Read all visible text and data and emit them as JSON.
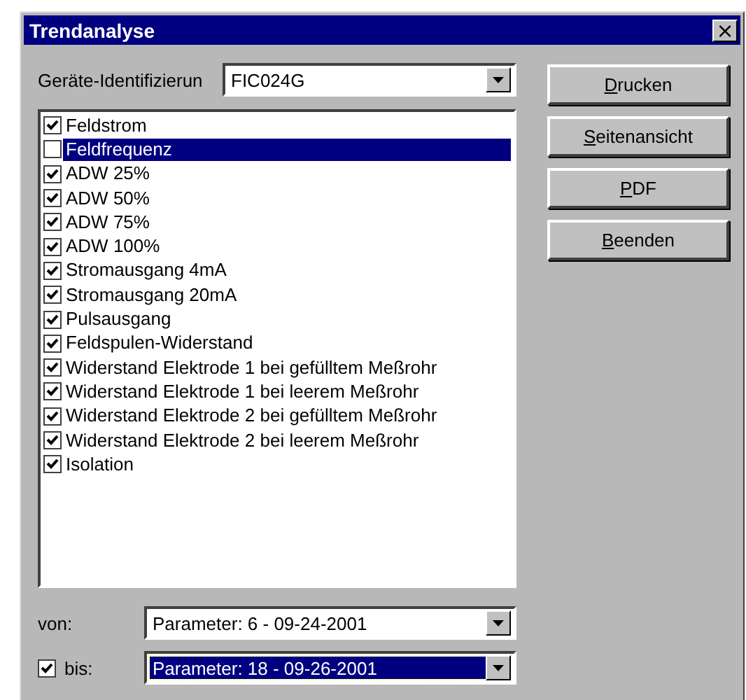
{
  "window": {
    "title": "Trendanalyse",
    "close": "×"
  },
  "device": {
    "label": "Geräte-Identifizierun",
    "value": "FIC024G"
  },
  "parameters": [
    {
      "label": "Feldstrom",
      "checked": true,
      "selected": false
    },
    {
      "label": "Feldfrequenz",
      "checked": false,
      "selected": true
    },
    {
      "label": "ADW 25%",
      "checked": true,
      "selected": false
    },
    {
      "label": "ADW 50%",
      "checked": true,
      "selected": false
    },
    {
      "label": "ADW 75%",
      "checked": true,
      "selected": false
    },
    {
      "label": "ADW 100%",
      "checked": true,
      "selected": false
    },
    {
      "label": "Stromausgang 4mA",
      "checked": true,
      "selected": false
    },
    {
      "label": "Stromausgang 20mA",
      "checked": true,
      "selected": false
    },
    {
      "label": "Pulsausgang",
      "checked": true,
      "selected": false
    },
    {
      "label": "Feldspulen-Widerstand",
      "checked": true,
      "selected": false
    },
    {
      "label": "Widerstand Elektrode 1 bei gefülltem Meßrohr",
      "checked": true,
      "selected": false
    },
    {
      "label": "Widerstand Elektrode 1 bei leerem Meßrohr",
      "checked": true,
      "selected": false
    },
    {
      "label": "Widerstand Elektrode 2 bei gefülltem Meßrohr",
      "checked": true,
      "selected": false
    },
    {
      "label": "Widerstand Elektrode 2 bei leerem Meßrohr",
      "checked": true,
      "selected": false
    },
    {
      "label": "Isolation",
      "checked": true,
      "selected": false
    }
  ],
  "range": {
    "from": {
      "label": "von:",
      "value": "Parameter: 6 - 09-24-2001",
      "focused": false
    },
    "to": {
      "label": "bis:",
      "checked": true,
      "value": "Parameter: 18 - 09-26-2001",
      "focused": true
    }
  },
  "buttons": [
    {
      "access_key": "D",
      "label_rest": "rucken"
    },
    {
      "access_key": "S",
      "label_rest": "eitenansicht"
    },
    {
      "access_key": "P",
      "label_rest": "DF"
    },
    {
      "access_key": "B",
      "label_rest": "eenden"
    }
  ]
}
